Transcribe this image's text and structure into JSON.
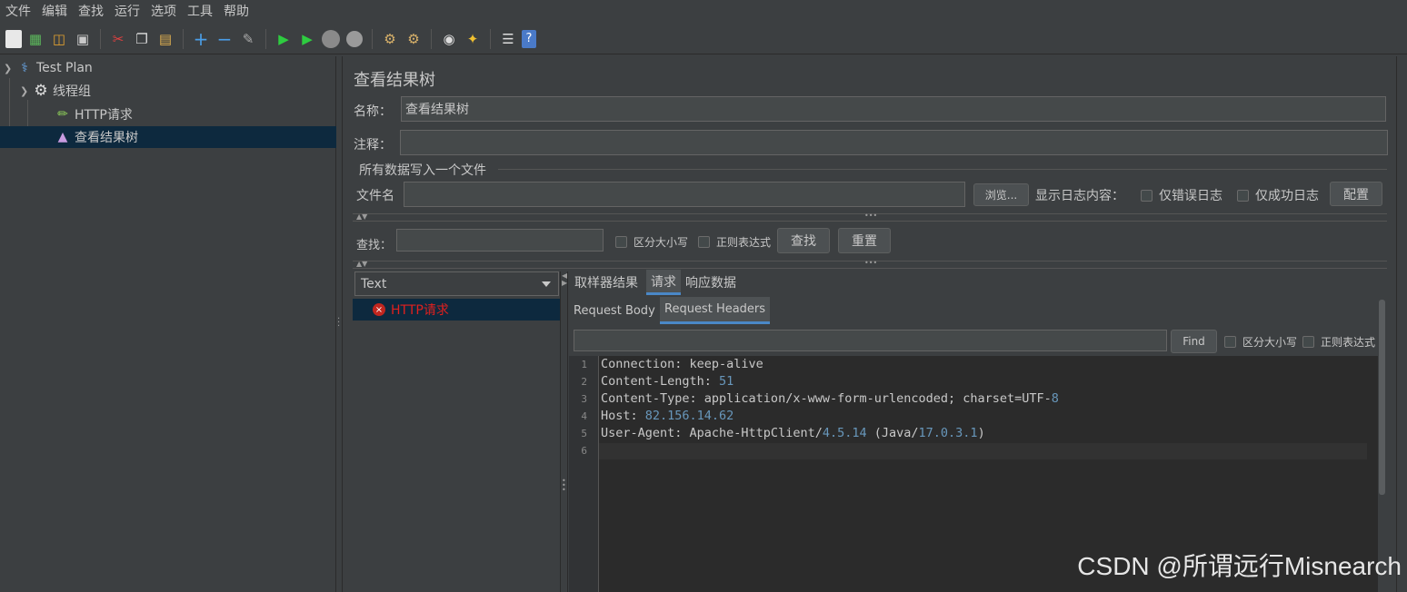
{
  "menu": [
    "文件",
    "编辑",
    "查找",
    "运行",
    "选项",
    "工具",
    "帮助"
  ],
  "toolbar_icons": [
    "new-icon",
    "templates-icon",
    "open-icon",
    "save-icon",
    "cut-icon",
    "copy-icon",
    "paste-icon",
    "expand-icon",
    "collapse-icon",
    "toggle-icon",
    "start-icon",
    "start-no-pause-icon",
    "stop-icon",
    "shutdown-icon",
    "clear-icon",
    "clear-all-icon",
    "search-icon",
    "reset-search-icon",
    "function-helper-icon",
    "help-icon"
  ],
  "tree": {
    "items": [
      {
        "label": "Test Plan",
        "icon": "flask-icon"
      },
      {
        "label": "线程组",
        "icon": "gear-icon"
      },
      {
        "label": "HTTP请求",
        "icon": "pipette-icon"
      },
      {
        "label": "查看结果树",
        "icon": "graph-icon"
      }
    ]
  },
  "panel": {
    "title": "查看结果树",
    "name_label": "名称：",
    "name_value": "查看结果树",
    "comment_label": "注释：",
    "comment_value": "",
    "file_group_title": "所有数据写入一个文件",
    "filename_label": "文件名",
    "filename_value": "",
    "browse_button": "浏览...",
    "log_label": "显示日志内容：",
    "errors_only": "仅错误日志",
    "success_only": "仅成功日志",
    "config_button": "配置",
    "search_label": "查找：",
    "search_value": "",
    "case_sensitive": "区分大小写",
    "regex": "正则表达式",
    "find_button": "查找",
    "reset_button": "重置"
  },
  "results": {
    "renderer": "Text",
    "items": [
      "HTTP请求"
    ]
  },
  "tabs": {
    "main": [
      "取样器结果",
      "请求",
      "响应数据"
    ],
    "active_main": "请求",
    "sub": [
      "Request Body",
      "Request Headers"
    ],
    "active_sub": "Request Headers"
  },
  "editor_search": {
    "value": "",
    "find_button": "Find",
    "case_sensitive": "区分大小写",
    "regex": "正则表达式"
  },
  "editor": {
    "line_numbers": [
      "1",
      "2",
      "3",
      "4",
      "5",
      "6"
    ],
    "lines": [
      "Connection: keep-alive",
      "Content-Length: 51",
      "Content-Type: application/x-www-form-urlencoded; charset=UTF-8",
      "Host: 82.156.14.62",
      "User-Agent: Apache-HttpClient/4.5.14 (Java/17.0.3.1)",
      ""
    ]
  },
  "watermark": "CSDN @所谓远行Misnearch"
}
